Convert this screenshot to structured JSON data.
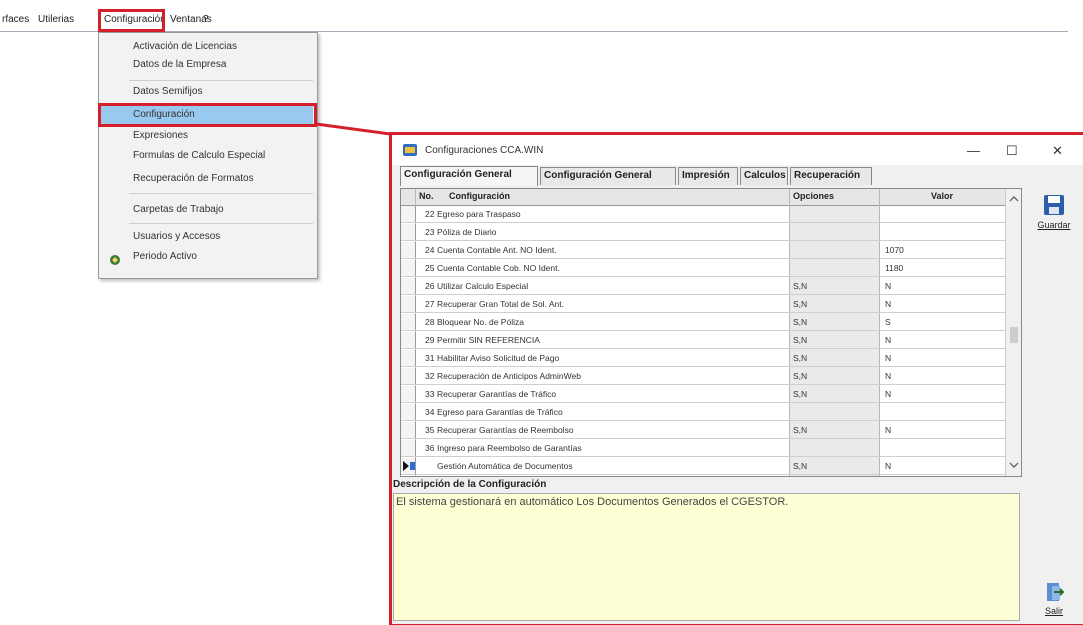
{
  "menubar": {
    "items": [
      "rfaces",
      "Utilerias",
      "Configuración",
      "Ventanas",
      "?"
    ]
  },
  "dropdown": {
    "items": [
      "Activación de Licencias",
      "Datos de la Empresa",
      "Datos Semifijos",
      "Configuración",
      "Expresiones",
      "Formulas de Calculo Especial",
      "Recuperación de Formatos",
      "Carpetas de Trabajo",
      "Usuarios y Accesos",
      "Periodo Activo"
    ]
  },
  "window": {
    "title": "Configuraciones CCA.WIN",
    "minimize": "—",
    "maximize": "☐",
    "close": "✕"
  },
  "tabs": [
    "Configuración General",
    "Configuración General",
    "Impresión",
    "Calculos",
    "Recuperación"
  ],
  "grid": {
    "headers": {
      "no": "No.",
      "config": "Configuración",
      "opciones": "Opciones",
      "valor": "Valor"
    },
    "rows": [
      {
        "no": "22",
        "config": "Egreso para Traspaso",
        "opciones": "",
        "valor": ""
      },
      {
        "no": "23",
        "config": "Póliza de Diario",
        "opciones": "",
        "valor": ""
      },
      {
        "no": "24",
        "config": "Cuenta Contable Ant. NO Ident.",
        "opciones": "",
        "valor": "1070"
      },
      {
        "no": "25",
        "config": "Cuenta Contable Cob. NO Ident.",
        "opciones": "",
        "valor": "1180"
      },
      {
        "no": "26",
        "config": "Utilizar Calculo Especial",
        "opciones": "S,N",
        "valor": "N"
      },
      {
        "no": "27",
        "config": "Recuperar Gran Total de Sol. Ant.",
        "opciones": "S,N",
        "valor": "N"
      },
      {
        "no": "28",
        "config": "Bloquear No. de Póliza",
        "opciones": "S,N",
        "valor": "S"
      },
      {
        "no": "29",
        "config": "Permitir SIN REFERENCIA",
        "opciones": "S,N",
        "valor": "N"
      },
      {
        "no": "31",
        "config": "Habilitar Aviso Solicitud de Pago",
        "opciones": "S,N",
        "valor": "N"
      },
      {
        "no": "32",
        "config": "Recuperación de Anticipos AdminWeb",
        "opciones": "S,N",
        "valor": "N"
      },
      {
        "no": "33",
        "config": "Recuperar Garantías de Tráfico",
        "opciones": "S,N",
        "valor": "N"
      },
      {
        "no": "34",
        "config": "Egreso para Garantías de Tráfico",
        "opciones": "",
        "valor": ""
      },
      {
        "no": "35",
        "config": "Recuperar Garantías de Reembolso",
        "opciones": "S,N",
        "valor": "N"
      },
      {
        "no": "36",
        "config": "Ingreso para Reembolso de Garantías",
        "opciones": "",
        "valor": ""
      },
      {
        "no": "",
        "config": "Gestión Automática de Documentos",
        "opciones": "S,N",
        "valor": "N"
      }
    ]
  },
  "description": {
    "label": "Descripción de la Configuración",
    "text": "El sistema gestionará en automático Los Documentos Generados el CGESTOR."
  },
  "buttons": {
    "save": "Guardar",
    "exit": "Salir"
  },
  "colors": {
    "highlight": "#d4202a",
    "selected_menu": "#99c9ee",
    "desc_bg": "#ffffd5"
  }
}
